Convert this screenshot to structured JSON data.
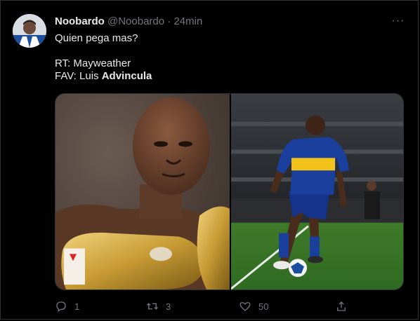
{
  "tweet": {
    "display_name": "Noobardo",
    "handle": "@Noobardo",
    "separator": "·",
    "time": "24min",
    "more_label": "···",
    "text_line1": "Quien pega mas?",
    "rt_line": "RT: Mayweather",
    "fav_prefix": "FAV: Luis ",
    "fav_bold": "Advincula"
  },
  "actions": {
    "reply_count": "1",
    "retweet_count": "3",
    "like_count": "50"
  },
  "colors": {
    "background": "#000000",
    "text": "#e7e9ea",
    "muted": "#71767b",
    "border": "#2f3336"
  },
  "icons": [
    "reply-icon",
    "retweet-icon",
    "heart-icon",
    "share-icon",
    "more-icon"
  ]
}
